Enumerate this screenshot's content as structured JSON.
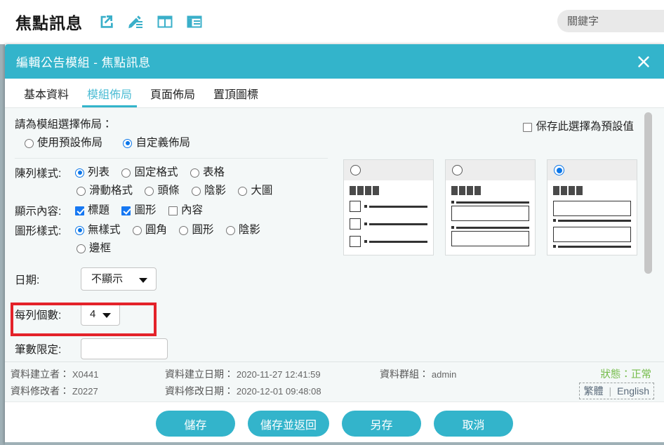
{
  "page": {
    "title": "焦點訊息",
    "icons": [
      "external-link-icon",
      "edit-pencil-icon",
      "table-layout-icon",
      "list-layout-icon"
    ],
    "search_placeholder": "關鍵字",
    "search_value": ""
  },
  "dialog": {
    "title": "編輯公告模組 - 焦點訊息",
    "close_label": "✕",
    "accent_color": "#33b4cb"
  },
  "tabs": [
    {
      "label": "基本資料",
      "active": false
    },
    {
      "label": "模組佈局",
      "active": true
    },
    {
      "label": "頁面佈局",
      "active": false
    },
    {
      "label": "置頂圖標",
      "active": false
    }
  ],
  "form": {
    "layout_prompt": "請為模組選擇佈局：",
    "save_default_label": "保存此選擇為預設值",
    "save_default_checked": false,
    "layout_mode": {
      "options": [
        {
          "label": "使用預設佈局",
          "selected": false
        },
        {
          "label": "自定義佈局",
          "selected": true
        }
      ]
    },
    "display_style": {
      "label": "陳列樣式:",
      "row1": [
        {
          "label": "列表",
          "selected": true
        },
        {
          "label": "固定格式",
          "selected": false
        },
        {
          "label": "表格",
          "selected": false
        }
      ],
      "row2": [
        {
          "label": "滑動格式",
          "selected": false
        },
        {
          "label": "頭條",
          "selected": false
        },
        {
          "label": "陰影",
          "selected": false
        },
        {
          "label": "大圖",
          "selected": false
        }
      ]
    },
    "display_content": {
      "label": "顯示內容:",
      "options": [
        {
          "label": "標題",
          "checked": true
        },
        {
          "label": "圖形",
          "checked": true
        },
        {
          "label": "內容",
          "checked": false
        }
      ]
    },
    "image_style": {
      "label": "圖形樣式:",
      "row1": [
        {
          "label": "無樣式",
          "selected": true
        },
        {
          "label": "圓角",
          "selected": false
        },
        {
          "label": "圓形",
          "selected": false
        },
        {
          "label": "陰影",
          "selected": false
        }
      ],
      "row2": [
        {
          "label": "邊框",
          "selected": false
        }
      ]
    },
    "date": {
      "label": "日期:",
      "value": "不顯示"
    },
    "per_row": {
      "label": "每列個數:",
      "value": "4",
      "highlighted": true,
      "highlight_color": "#e4222a"
    },
    "limit": {
      "label": "筆數限定:",
      "value": ""
    }
  },
  "preview_cards": [
    {
      "name": "layout-card-1",
      "selected": false
    },
    {
      "name": "layout-card-2",
      "selected": false
    },
    {
      "name": "layout-card-3",
      "selected": true
    }
  ],
  "meta": {
    "creator_label": "資料建立者：",
    "creator_value": "X0441",
    "modifier_label": "資料修改者：",
    "modifier_value": "Z0227",
    "created_label": "資料建立日期：",
    "created_value": "2020-11-27 12:41:59",
    "modified_label": "資料修改日期：",
    "modified_value": "2020-12-01 09:48:08",
    "group_label": "資料群組：",
    "group_value": "admin",
    "status_text": "狀態：正常",
    "status_color": "#74bb49",
    "lang_zh": "繁體",
    "lang_en": "English"
  },
  "buttons": [
    {
      "label": "儲存",
      "name": "save-button"
    },
    {
      "label": "儲存並返回",
      "name": "save-and-return-button"
    },
    {
      "label": "另存",
      "name": "save-as-button"
    },
    {
      "label": "取消",
      "name": "cancel-button"
    }
  ]
}
